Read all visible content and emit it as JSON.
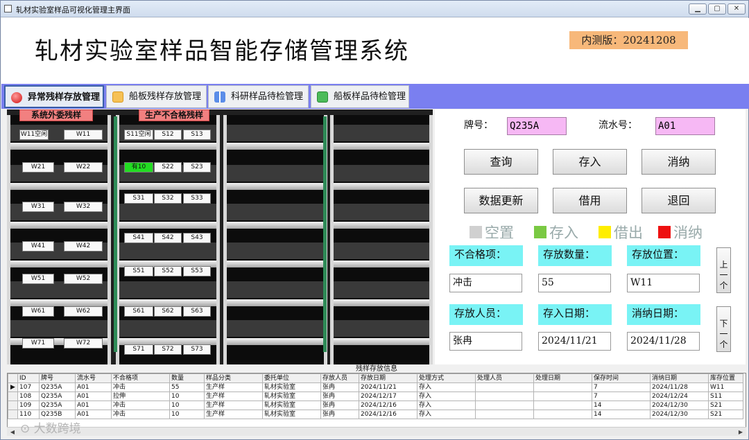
{
  "window": {
    "title": "轧材实验室样品可视化管理主界面",
    "controls": [
      "minimize",
      "maximize",
      "close"
    ]
  },
  "header": {
    "title": "轧材实验室样品智能存储管理系统",
    "version": "内测版：20241208"
  },
  "tabs": [
    {
      "label": "异常残样存放管理",
      "icon": "red-ball-icon",
      "active": true
    },
    {
      "label": "船板残样存放管理",
      "icon": "box-icon",
      "active": false
    },
    {
      "label": "科研样品待检管理",
      "icon": "grid-icon",
      "active": false
    },
    {
      "label": "船板样品待检管理",
      "icon": "green-doc-icon",
      "active": false
    }
  ],
  "shelves": {
    "labels": [
      "系统外委残样",
      "生产不合格残样"
    ],
    "col1": [
      "W11空闲",
      "W11",
      "W21",
      "W22",
      "W31",
      "W32",
      "W41",
      "W42",
      "W51",
      "W52",
      "W61",
      "W62",
      "W71",
      "W72"
    ],
    "col2": [
      "S11空闲",
      "S12",
      "S13",
      "有10",
      "S22",
      "S23",
      "S31",
      "S32",
      "S33",
      "S41",
      "S42",
      "S43",
      "S51",
      "S52",
      "S53",
      "S61",
      "S62",
      "S63",
      "S71",
      "S72",
      "S73"
    ],
    "occupied_color": "#22dd22"
  },
  "query": {
    "brand_label": "牌号：",
    "brand_value": "Q235A",
    "serial_label": "流水号：",
    "serial_value": "A01"
  },
  "buttons": {
    "query": "查询",
    "store": "存入",
    "consume": "消纳",
    "refresh": "数据更新",
    "borrow": "借用",
    "return": "退回",
    "up": "上一个",
    "down": "下一个"
  },
  "legend": [
    {
      "label": "空置",
      "color": "#d0d0d0"
    },
    {
      "label": "存入",
      "color": "#7ac943"
    },
    {
      "label": "借出",
      "color": "#ffee00"
    },
    {
      "label": "消纳",
      "color": "#ee1111"
    }
  ],
  "details": {
    "defect_label": "不合格项：",
    "defect_value": "冲击",
    "qty_label": "存放数量：",
    "qty_value": "55",
    "location_label": "存放位置：",
    "location_value": "W11",
    "person_label": "存放人员：",
    "person_value": "张冉",
    "store_date_label": "存入日期：",
    "store_date_value": "2024/11/21",
    "consume_date_label": "消纳日期：",
    "consume_date_value": "2024/11/28"
  },
  "grid": {
    "title": "残样存放信息",
    "columns": [
      "ID",
      "牌号",
      "流水号",
      "不合格项",
      "数量",
      "样品分类",
      "委托单位",
      "存放人员",
      "存放日期",
      "处理方式",
      "处理人员",
      "处理日期",
      "保存时间",
      "消纳日期",
      "库存位置"
    ],
    "rows": [
      [
        "107",
        "Q235A",
        "A01",
        "冲击",
        "55",
        "生产样",
        "轧材实验室",
        "张冉",
        "2024/11/21",
        "存入",
        "",
        "",
        "7",
        "2024/11/28",
        "W11"
      ],
      [
        "108",
        "Q235A",
        "A01",
        "拉伸",
        "10",
        "生产样",
        "轧材实验室",
        "张冉",
        "2024/12/17",
        "存入",
        "",
        "",
        "7",
        "2024/12/24",
        "S11"
      ],
      [
        "109",
        "Q235A",
        "A01",
        "冲击",
        "10",
        "生产样",
        "轧材实验室",
        "张冉",
        "2024/12/16",
        "存入",
        "",
        "",
        "14",
        "2024/12/30",
        "S21"
      ],
      [
        "110",
        "Q235B",
        "A01",
        "冲击",
        "10",
        "生产样",
        "轧材实验室",
        "张冉",
        "2024/12/16",
        "存入",
        "",
        "",
        "14",
        "2024/12/30",
        "S21"
      ]
    ]
  },
  "watermark": "大数跨境"
}
